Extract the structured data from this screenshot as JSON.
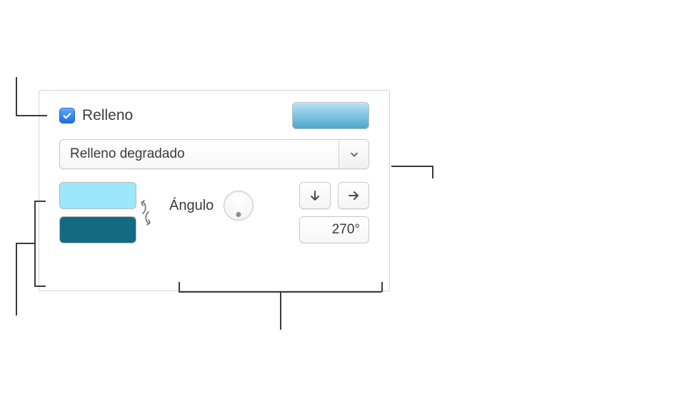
{
  "header": {
    "fill_label": "Relleno",
    "checked": true
  },
  "preview": {
    "gradient_start": "#b6e2f6",
    "gradient_end": "#4ba8cb"
  },
  "fill_type": {
    "selected_label": "Relleno degradado"
  },
  "swatches": {
    "color1": "#9de7fb",
    "color2": "#156a83"
  },
  "angle": {
    "label": "Ángulo",
    "value_display": "270°"
  }
}
